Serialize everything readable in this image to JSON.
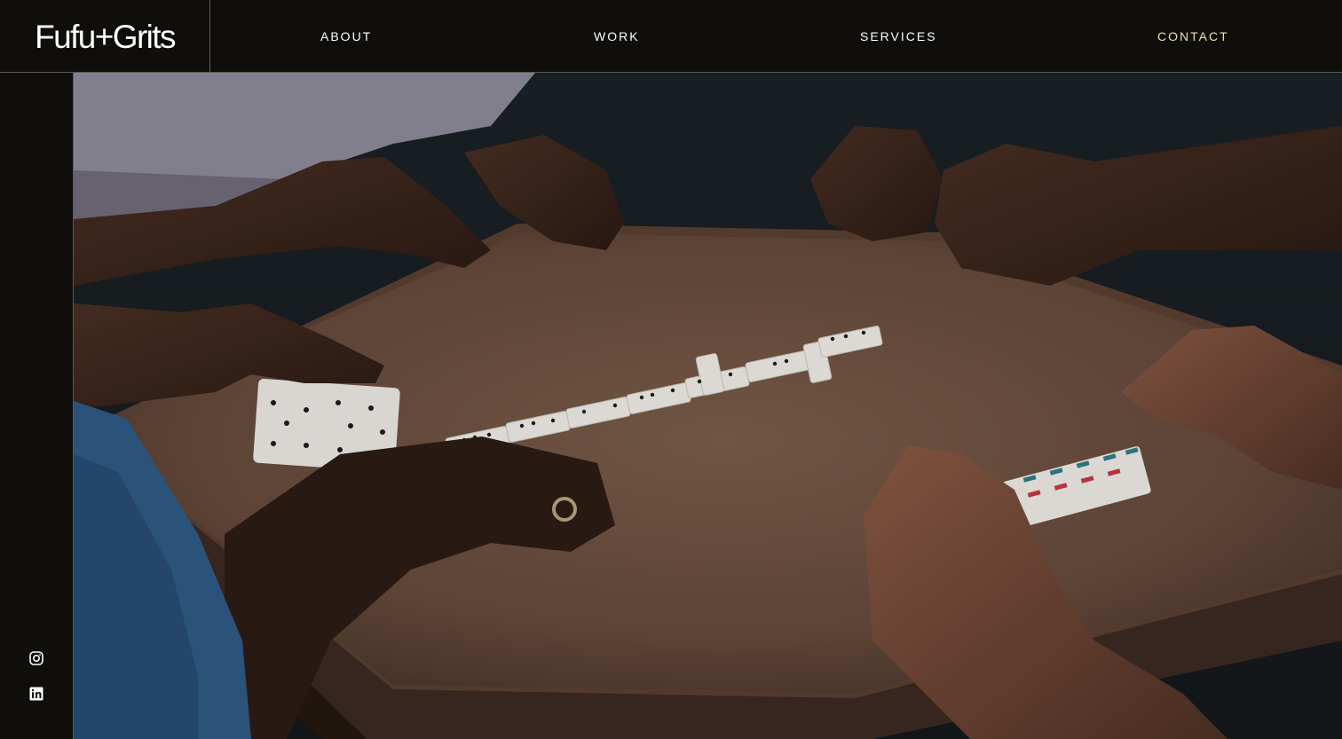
{
  "brand": {
    "name": "Fufu+Grits"
  },
  "nav": {
    "items": [
      {
        "label": "ABOUT"
      },
      {
        "label": "WORK"
      },
      {
        "label": "SERVICES"
      },
      {
        "label": "CONTACT"
      }
    ],
    "accent_color": "#f1dfb0"
  },
  "social": {
    "icons": [
      "instagram-icon",
      "linkedin-icon"
    ]
  },
  "hero": {
    "image_subject": "hands playing dominoes on a brown table"
  },
  "colors": {
    "background": "#0f0e0b",
    "text": "#ffffff",
    "divider": "#5a5953"
  }
}
